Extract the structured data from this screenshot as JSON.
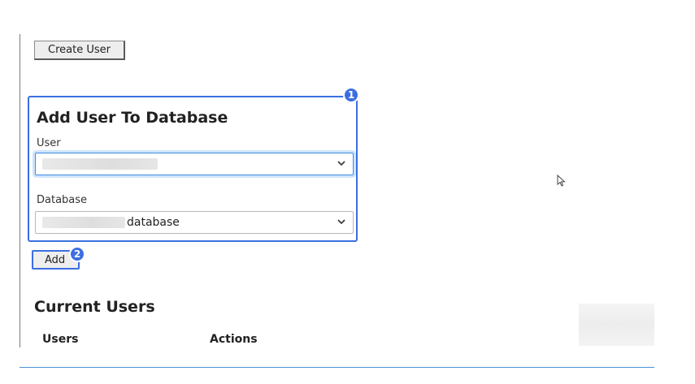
{
  "toolbar": {
    "create_user_label": "Create User"
  },
  "add_user_panel": {
    "title": "Add User To Database",
    "badge": "1",
    "user_field": {
      "label": "User",
      "value": ""
    },
    "database_field": {
      "label": "Database",
      "value": "database"
    }
  },
  "add_button": {
    "label": "Add",
    "badge": "2"
  },
  "current_users": {
    "title": "Current Users",
    "columns": [
      "Users",
      "Actions"
    ]
  },
  "icons": {
    "dropdown": "chevron-down-icon",
    "cursor": "mouse-pointer-icon"
  },
  "colors": {
    "highlight": "#3b6fe0",
    "focus_ring": "#cfe4fb",
    "divider": "#4a90d9"
  }
}
